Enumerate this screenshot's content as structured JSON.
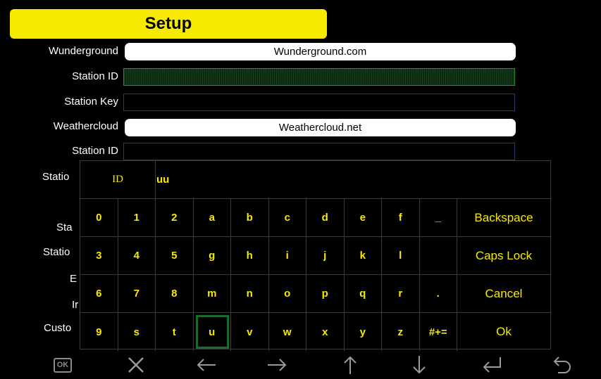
{
  "header": {
    "title": "Setup"
  },
  "form": {
    "wunderground_label": "Wunderground",
    "wunderground_link": "Wunderground.com",
    "station_id_label": "Station ID",
    "station_key_label": "Station Key",
    "weathercloud_label": "Weathercloud",
    "weathercloud_link": "Weathercloud.net",
    "station_id_label_2": "Station ID",
    "station_key_label_2": "Statio",
    "row7_label": "Sta",
    "row8_label": "Statio",
    "row9_label": "E",
    "row10_label": "Ir",
    "row11_label": "Custo"
  },
  "keyboard": {
    "field_name": "ID",
    "input_value": "uu",
    "rows": [
      [
        "0",
        "1",
        "2",
        "a",
        "b",
        "c",
        "d",
        "e",
        "f",
        "_"
      ],
      [
        "3",
        "4",
        "5",
        "g",
        "h",
        "i",
        "j",
        "k",
        "l",
        ""
      ],
      [
        "6",
        "7",
        "8",
        "m",
        "n",
        "o",
        "p",
        "q",
        "r",
        "."
      ],
      [
        "9",
        "s",
        "t",
        "u",
        "v",
        "w",
        "x",
        "y",
        "z",
        "#+="
      ]
    ],
    "actions": [
      "Backspace",
      "Caps Lock",
      "Cancel",
      "Ok"
    ],
    "selected_key": "u"
  },
  "bottom_bar": {
    "ok_icon_label": "OK",
    "icons": [
      "ok-icon",
      "close-icon",
      "arrow-left-icon",
      "arrow-right-icon",
      "arrow-up-icon",
      "arrow-down-icon",
      "enter-icon",
      "undo-icon"
    ]
  },
  "colors": {
    "accent": "#f7ea00",
    "selected": "#1c6a28",
    "field_border": "#253b6e"
  }
}
